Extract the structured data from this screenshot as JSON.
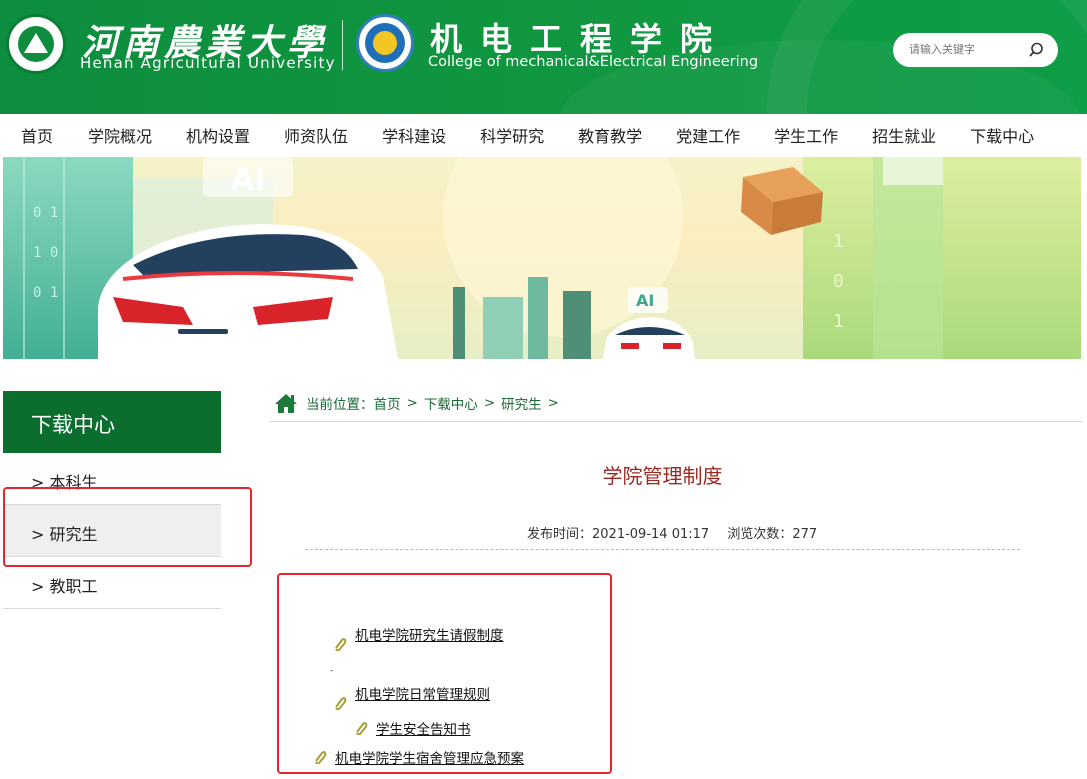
{
  "header": {
    "university_cn": "河南農業大學",
    "university_en": "Henan Agricultural University",
    "college_cn": "机电工程学院",
    "college_en": "College of mechanical&Electrical Engineering",
    "search_placeholder": "请输入关键字",
    "accent": "#0f9441"
  },
  "nav": {
    "items": [
      "首页",
      "学院概况",
      "机构设置",
      "师资队伍",
      "学科建设",
      "科学研究",
      "教育教学",
      "党建工作",
      "学生工作",
      "招生就业",
      "下载中心"
    ]
  },
  "banner": {
    "ai_label": "AI",
    "ai_label_small": "AI"
  },
  "sidebar": {
    "title": "下载中心",
    "items": [
      "> 本科生",
      "> 研究生",
      "> 教职工"
    ],
    "active_index": 1,
    "head_color": "#0b6e2f"
  },
  "breadcrumb": {
    "prefix": "当前位置：",
    "items": [
      "首页",
      "下载中心",
      "研究生"
    ],
    "sep": ">"
  },
  "article": {
    "title": "学院管理制度",
    "publish_label": "发布时间：",
    "publish_time": "2021-09-14 01:17",
    "views_label": "浏览次数：",
    "views": "277",
    "attachments": [
      "机电学院研究生请假制度",
      "机电学院日常管理规则",
      "学生安全告知书",
      "机电学院学生宿舍管理应急预案"
    ],
    "stray_mark": "-"
  }
}
